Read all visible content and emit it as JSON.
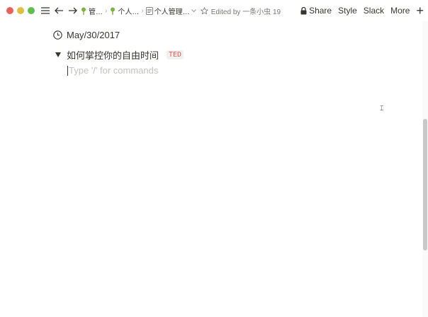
{
  "titlebar": {
    "breadcrumbs": [
      {
        "icon": "sprout-icon",
        "label": "管…"
      },
      {
        "icon": "sprout-icon",
        "label": "个人…"
      },
      {
        "icon": "page-icon",
        "label": "个人管理…"
      }
    ],
    "edited_text": "Edited by 一条小虫 19",
    "menu": {
      "share": "Share",
      "style": "Style",
      "slack": "Slack",
      "more": "More",
      "new": "+"
    }
  },
  "content": {
    "date": "May/30/2017",
    "toggle_title": "如何掌控你的自由时间",
    "tag": "TED",
    "placeholder": "Type '/' for commands"
  }
}
